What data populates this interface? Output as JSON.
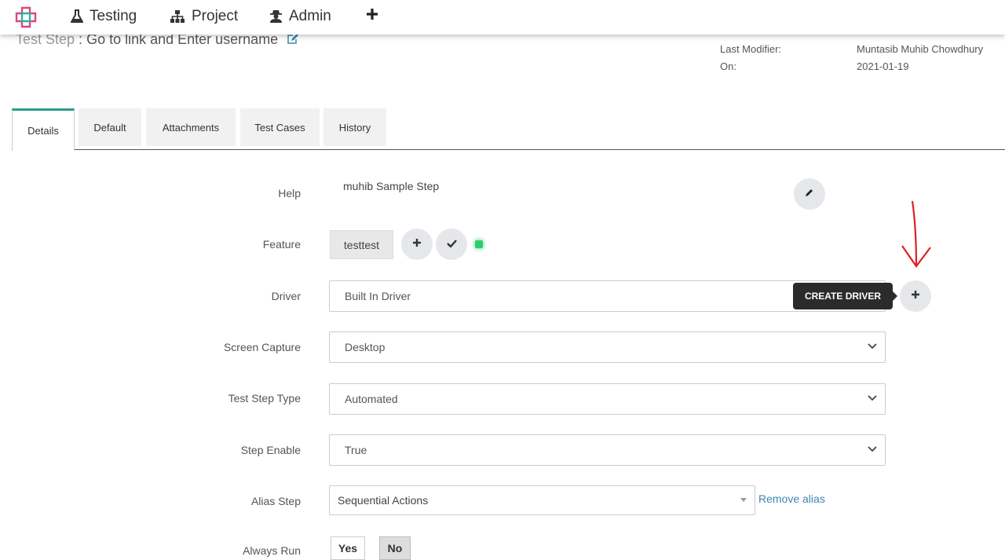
{
  "nav": {
    "logo": "app-logo",
    "items": [
      {
        "label": "Testing",
        "icon": "flask-icon"
      },
      {
        "label": "Project",
        "icon": "sitemap-icon"
      },
      {
        "label": "Admin",
        "icon": "user-secret-icon"
      }
    ],
    "add_icon": "plus-icon"
  },
  "header": {
    "title_label": "Test Step",
    "title_sep": " : ",
    "title_value": "Go to link and Enter username",
    "meta": {
      "last_modifier_label": "Last Modifier:",
      "last_modifier_value": "Muntasib Muhib Chowdhury",
      "on_label": "On:",
      "on_value": "2021-01-19"
    }
  },
  "tabs": [
    "Details",
    "Default",
    "Attachments",
    "Test Cases",
    "History"
  ],
  "active_tab": "Details",
  "form": {
    "help_label": "Help",
    "help_value": "muhib Sample Step",
    "feature_label": "Feature",
    "feature_value": "testtest",
    "driver_label": "Driver",
    "driver_value": "Built In Driver",
    "create_driver_tooltip": "CREATE DRIVER",
    "screen_capture_label": "Screen Capture",
    "screen_capture_value": "Desktop",
    "step_type_label": "Test Step Type",
    "step_type_value": "Automated",
    "step_enable_label": "Step Enable",
    "step_enable_value": "True",
    "alias_label": "Alias Step",
    "alias_value": "Sequential Actions",
    "remove_alias": "Remove alias",
    "always_run_label": "Always Run",
    "always_run_yes": "Yes",
    "always_run_no": "No",
    "always_run_selected": "No"
  },
  "colors": {
    "accent": "#2a9d8f",
    "status_green": "#2ecc71",
    "link": "#3a87ad",
    "annotation": "#e02020"
  }
}
